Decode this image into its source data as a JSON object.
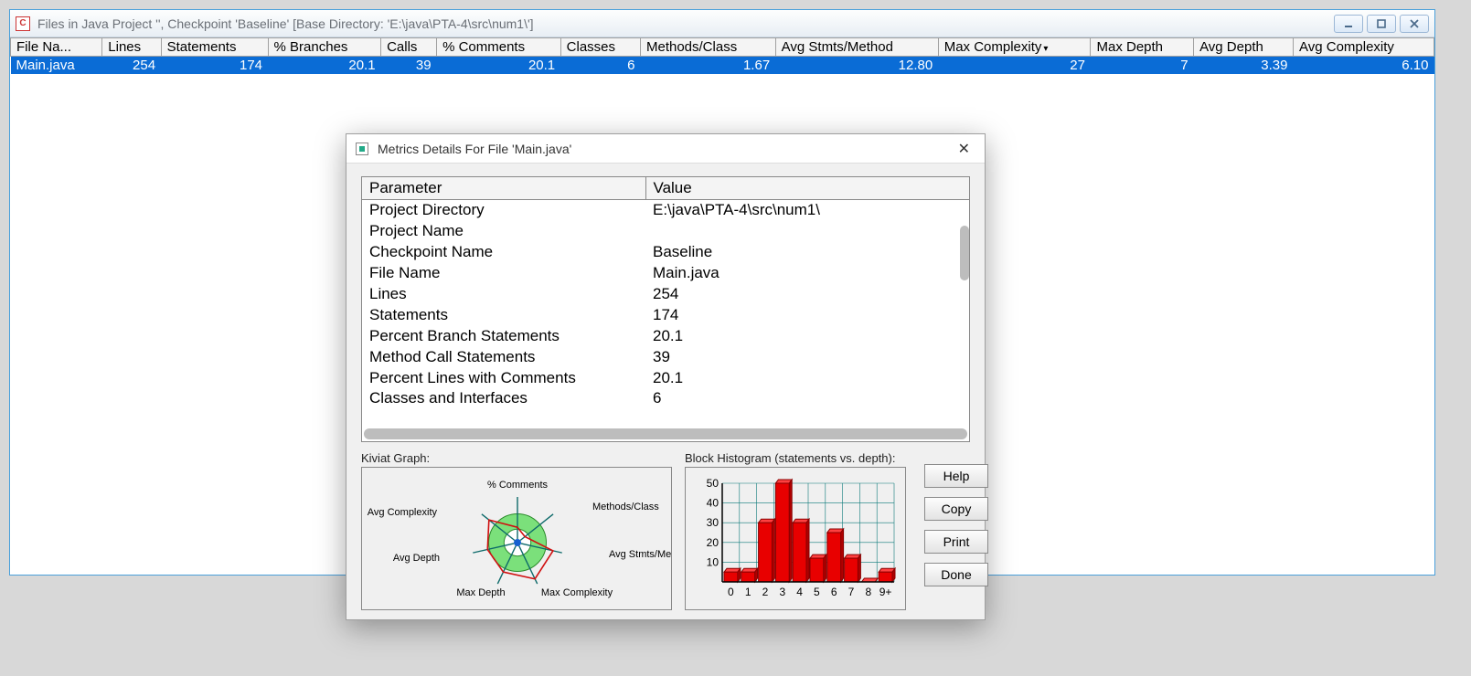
{
  "window": {
    "title": "Files in Java Project '', Checkpoint 'Baseline'  [Base Directory: 'E:\\java\\PTA-4\\src\\num1\\']"
  },
  "columns": [
    "File Na...",
    "Lines",
    "Statements",
    "% Branches",
    "Calls",
    "% Comments",
    "Classes",
    "Methods/Class",
    "Avg Stmts/Method",
    "Max Complexity",
    "Max Depth",
    "Avg Depth",
    "Avg Complexity"
  ],
  "sort_col_index": 9,
  "rows": [
    {
      "file": "Main.java",
      "lines": "254",
      "stmts": "174",
      "pctbr": "20.1",
      "calls": "39",
      "pctcom": "20.1",
      "classes": "6",
      "mpc": "1.67",
      "asm": "12.80",
      "maxc": "27",
      "maxd": "7",
      "avgd": "3.39",
      "avgc": "6.10"
    }
  ],
  "dialog": {
    "title": "Metrics Details For File 'Main.java'",
    "hdr_param": "Parameter",
    "hdr_value": "Value",
    "params": [
      {
        "k": "Project Directory",
        "v": "E:\\java\\PTA-4\\src\\num1\\"
      },
      {
        "k": "Project Name",
        "v": ""
      },
      {
        "k": "Checkpoint Name",
        "v": "Baseline"
      },
      {
        "k": "File Name",
        "v": "Main.java"
      },
      {
        "k": "Lines",
        "v": "254"
      },
      {
        "k": "Statements",
        "v": "174"
      },
      {
        "k": "Percent Branch Statements",
        "v": "20.1"
      },
      {
        "k": "Method Call Statements",
        "v": "39"
      },
      {
        "k": "Percent Lines with Comments",
        "v": "20.1"
      },
      {
        "k": "Classes and Interfaces",
        "v": "6"
      }
    ],
    "kiviat_label": "Kiviat Graph:",
    "kiviat_axes": [
      "% Comments",
      "Methods/Class",
      "Avg Stmts/Method",
      "Max Complexity",
      "Max Depth",
      "Avg Depth",
      "Avg Complexity"
    ],
    "hist_label": "Block Histogram (statements vs. depth):",
    "buttons": {
      "help": "Help",
      "copy": "Copy",
      "print": "Print",
      "done": "Done"
    }
  },
  "chart_data": [
    {
      "type": "radar",
      "title": "Kiviat Graph",
      "axes": [
        "% Comments",
        "Methods/Class",
        "Avg Stmts/Method",
        "Max Complexity",
        "Max Depth",
        "Avg Depth",
        "Avg Complexity"
      ],
      "values_norm": [
        0.4,
        0.25,
        0.95,
        1.05,
        0.85,
        0.8,
        0.95
      ],
      "green_band": [
        0.35,
        0.75
      ]
    },
    {
      "type": "bar",
      "title": "Block Histogram (statements vs. depth)",
      "xlabel": "depth",
      "ylabel": "statements",
      "categories": [
        "0",
        "1",
        "2",
        "3",
        "4",
        "5",
        "6",
        "7",
        "8",
        "9+"
      ],
      "values": [
        5,
        5,
        30,
        50,
        30,
        12,
        25,
        12,
        0,
        5
      ],
      "ylim": [
        0,
        50
      ],
      "yticks": [
        10,
        20,
        30,
        40,
        50
      ]
    }
  ]
}
